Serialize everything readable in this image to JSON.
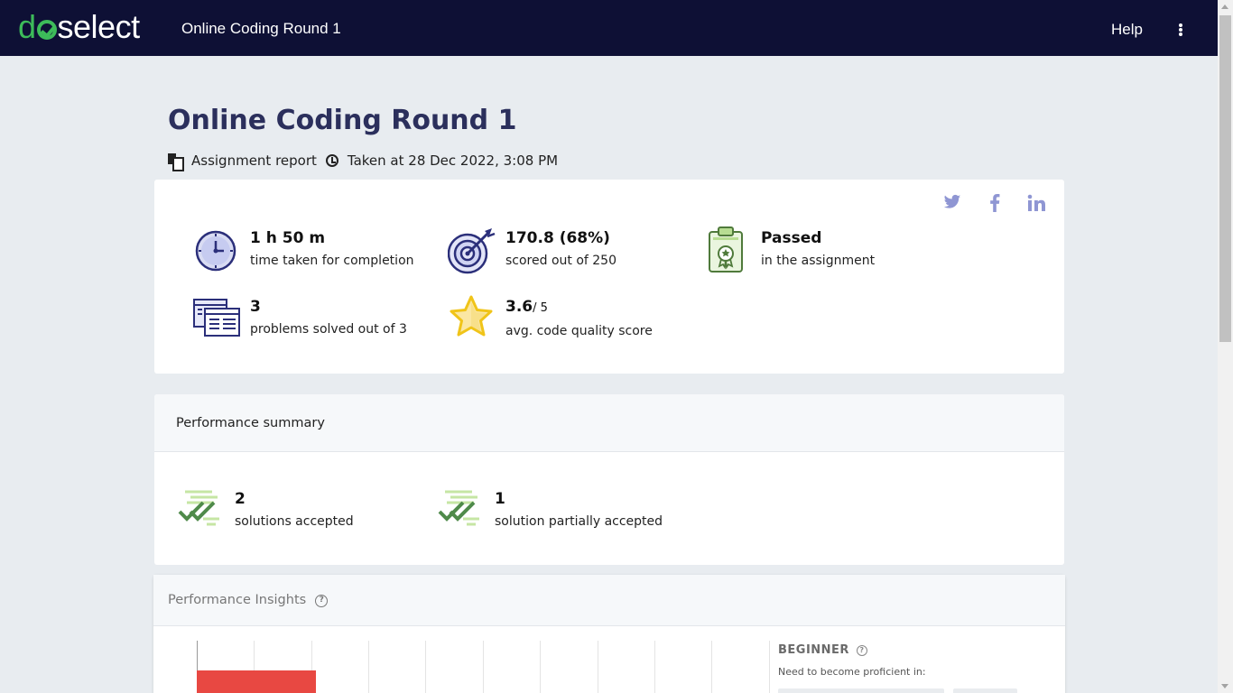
{
  "app": {
    "logo_text": "doselect",
    "title": "Online Coding Round 1"
  },
  "topbar": {
    "help_label": "Help"
  },
  "header": {
    "title": "Online Coding Round 1",
    "report_label": "Assignment report",
    "taken_label": "Taken at 28 Dec 2022, 3:08 PM"
  },
  "stats": {
    "time": {
      "value": "1 h 50 m",
      "label": "time taken for completion"
    },
    "score": {
      "value": "170.8 (68%)",
      "label": "scored out of 250"
    },
    "result": {
      "value": "Passed",
      "label": "in the assignment"
    },
    "problems": {
      "value": "3",
      "label": "problems solved out of 3"
    },
    "quality": {
      "value": "3.6",
      "out_of": "/ 5",
      "label": "avg. code quality score"
    }
  },
  "social": {
    "twitter_icon": "twitter-icon",
    "facebook_icon": "facebook-icon",
    "linkedin_icon": "linkedin-icon"
  },
  "performance_summary": {
    "title": "Performance summary",
    "items": [
      {
        "value": "2",
        "label": "solutions accepted"
      },
      {
        "value": "1",
        "label": "solution partially accepted"
      }
    ]
  },
  "performance_insights": {
    "title": "Performance Insights",
    "level": "BEGINNER",
    "level_sub": "Need to become proficient in:"
  },
  "colors": {
    "topbar": "#0e1035",
    "brand_green": "#3dbb5a",
    "title": "#2b2f5c",
    "bar_red": "#e84842",
    "social": "#8f96d3"
  }
}
